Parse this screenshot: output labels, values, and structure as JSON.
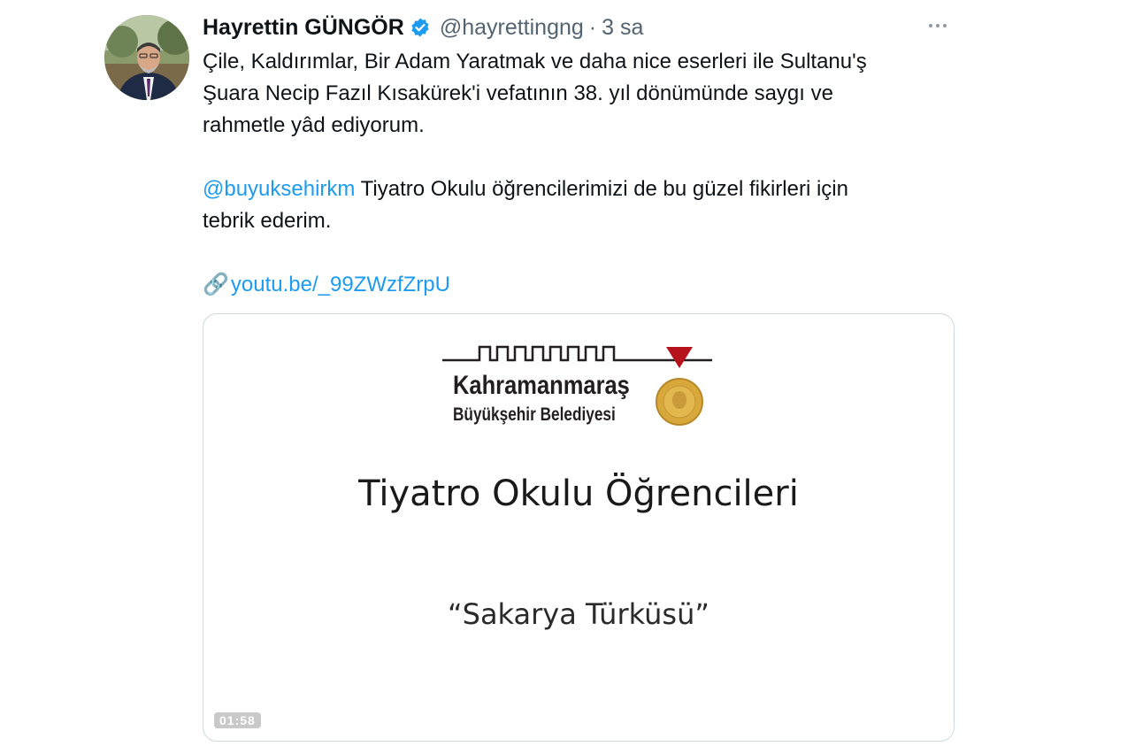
{
  "author": {
    "display_name": "Hayrettin GÜNGÖR",
    "handle": "@hayrettingng",
    "separator": "·",
    "time": "3 sa",
    "verified": true
  },
  "icons": {
    "verified": "verified-badge-icon",
    "more": "more-options-icon",
    "link": "link-chain-icon"
  },
  "tweet": {
    "line1": "Çile, Kaldırımlar, Bir Adam Yaratmak ve daha nice eserleri ile Sultanu'ş",
    "line2": "Şuara Necip Fazıl Kısakürek'i vefatının 38. yıl dönümünde saygı ve",
    "line3": "rahmetle yâd ediyorum.",
    "mention": "@buyuksehirkm",
    "mention_text_1": " Tiyatro Okulu öğrencilerimizi de bu güzel fikirleri için",
    "mention_text_2": "tebrik ederim.",
    "link_emoji": "🔗",
    "link_text": "youtu.be/_99ZWzfZrpU"
  },
  "card": {
    "logo_title": "Kahramanmaraş",
    "logo_subtitle": "Büyükşehir Belediyesi",
    "video_title": "Tiyatro Okulu Öğrencileri",
    "video_subtitle": "“Sakarya Türküsü”",
    "duration": "01:58"
  },
  "colors": {
    "link": "#1d9bf0",
    "secondary_text": "#536471",
    "card_border": "#cfd9de",
    "logo_red": "#b5121b",
    "medal_gold": "#d8a93a"
  }
}
